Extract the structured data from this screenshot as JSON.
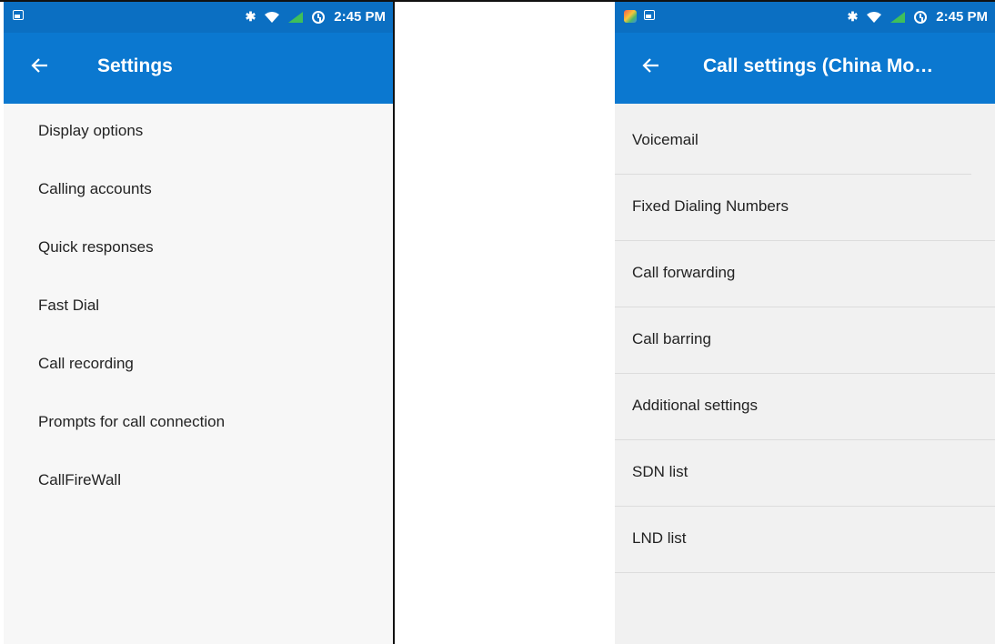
{
  "left_screen": {
    "status_bar": {
      "time": "2:45 PM"
    },
    "app_bar": {
      "title": "Settings"
    },
    "items": [
      {
        "label": "Display options"
      },
      {
        "label": "Calling accounts"
      },
      {
        "label": "Quick responses"
      },
      {
        "label": "Fast Dial"
      },
      {
        "label": "Call recording"
      },
      {
        "label": "Prompts for call connection"
      },
      {
        "label": "CallFireWall"
      }
    ]
  },
  "right_screen": {
    "status_bar": {
      "time": "2:45 PM"
    },
    "app_bar": {
      "title": "Call settings (China Mo…"
    },
    "items": [
      {
        "label": "Voicemail"
      },
      {
        "label": "Fixed Dialing Numbers"
      },
      {
        "label": "Call forwarding"
      },
      {
        "label": "Call barring"
      },
      {
        "label": "Additional settings"
      },
      {
        "label": "SDN list"
      },
      {
        "label": "LND list"
      }
    ]
  },
  "colors": {
    "status_bar": "#0b6fc2",
    "app_bar": "#0b78d0",
    "list_bg": "#f7f7f7",
    "text": "#222222"
  },
  "icons": [
    "gallery-icon",
    "app-icon",
    "bluetooth-icon",
    "wifi-icon",
    "signal-icon",
    "alarm-icon",
    "back-arrow-icon"
  ]
}
